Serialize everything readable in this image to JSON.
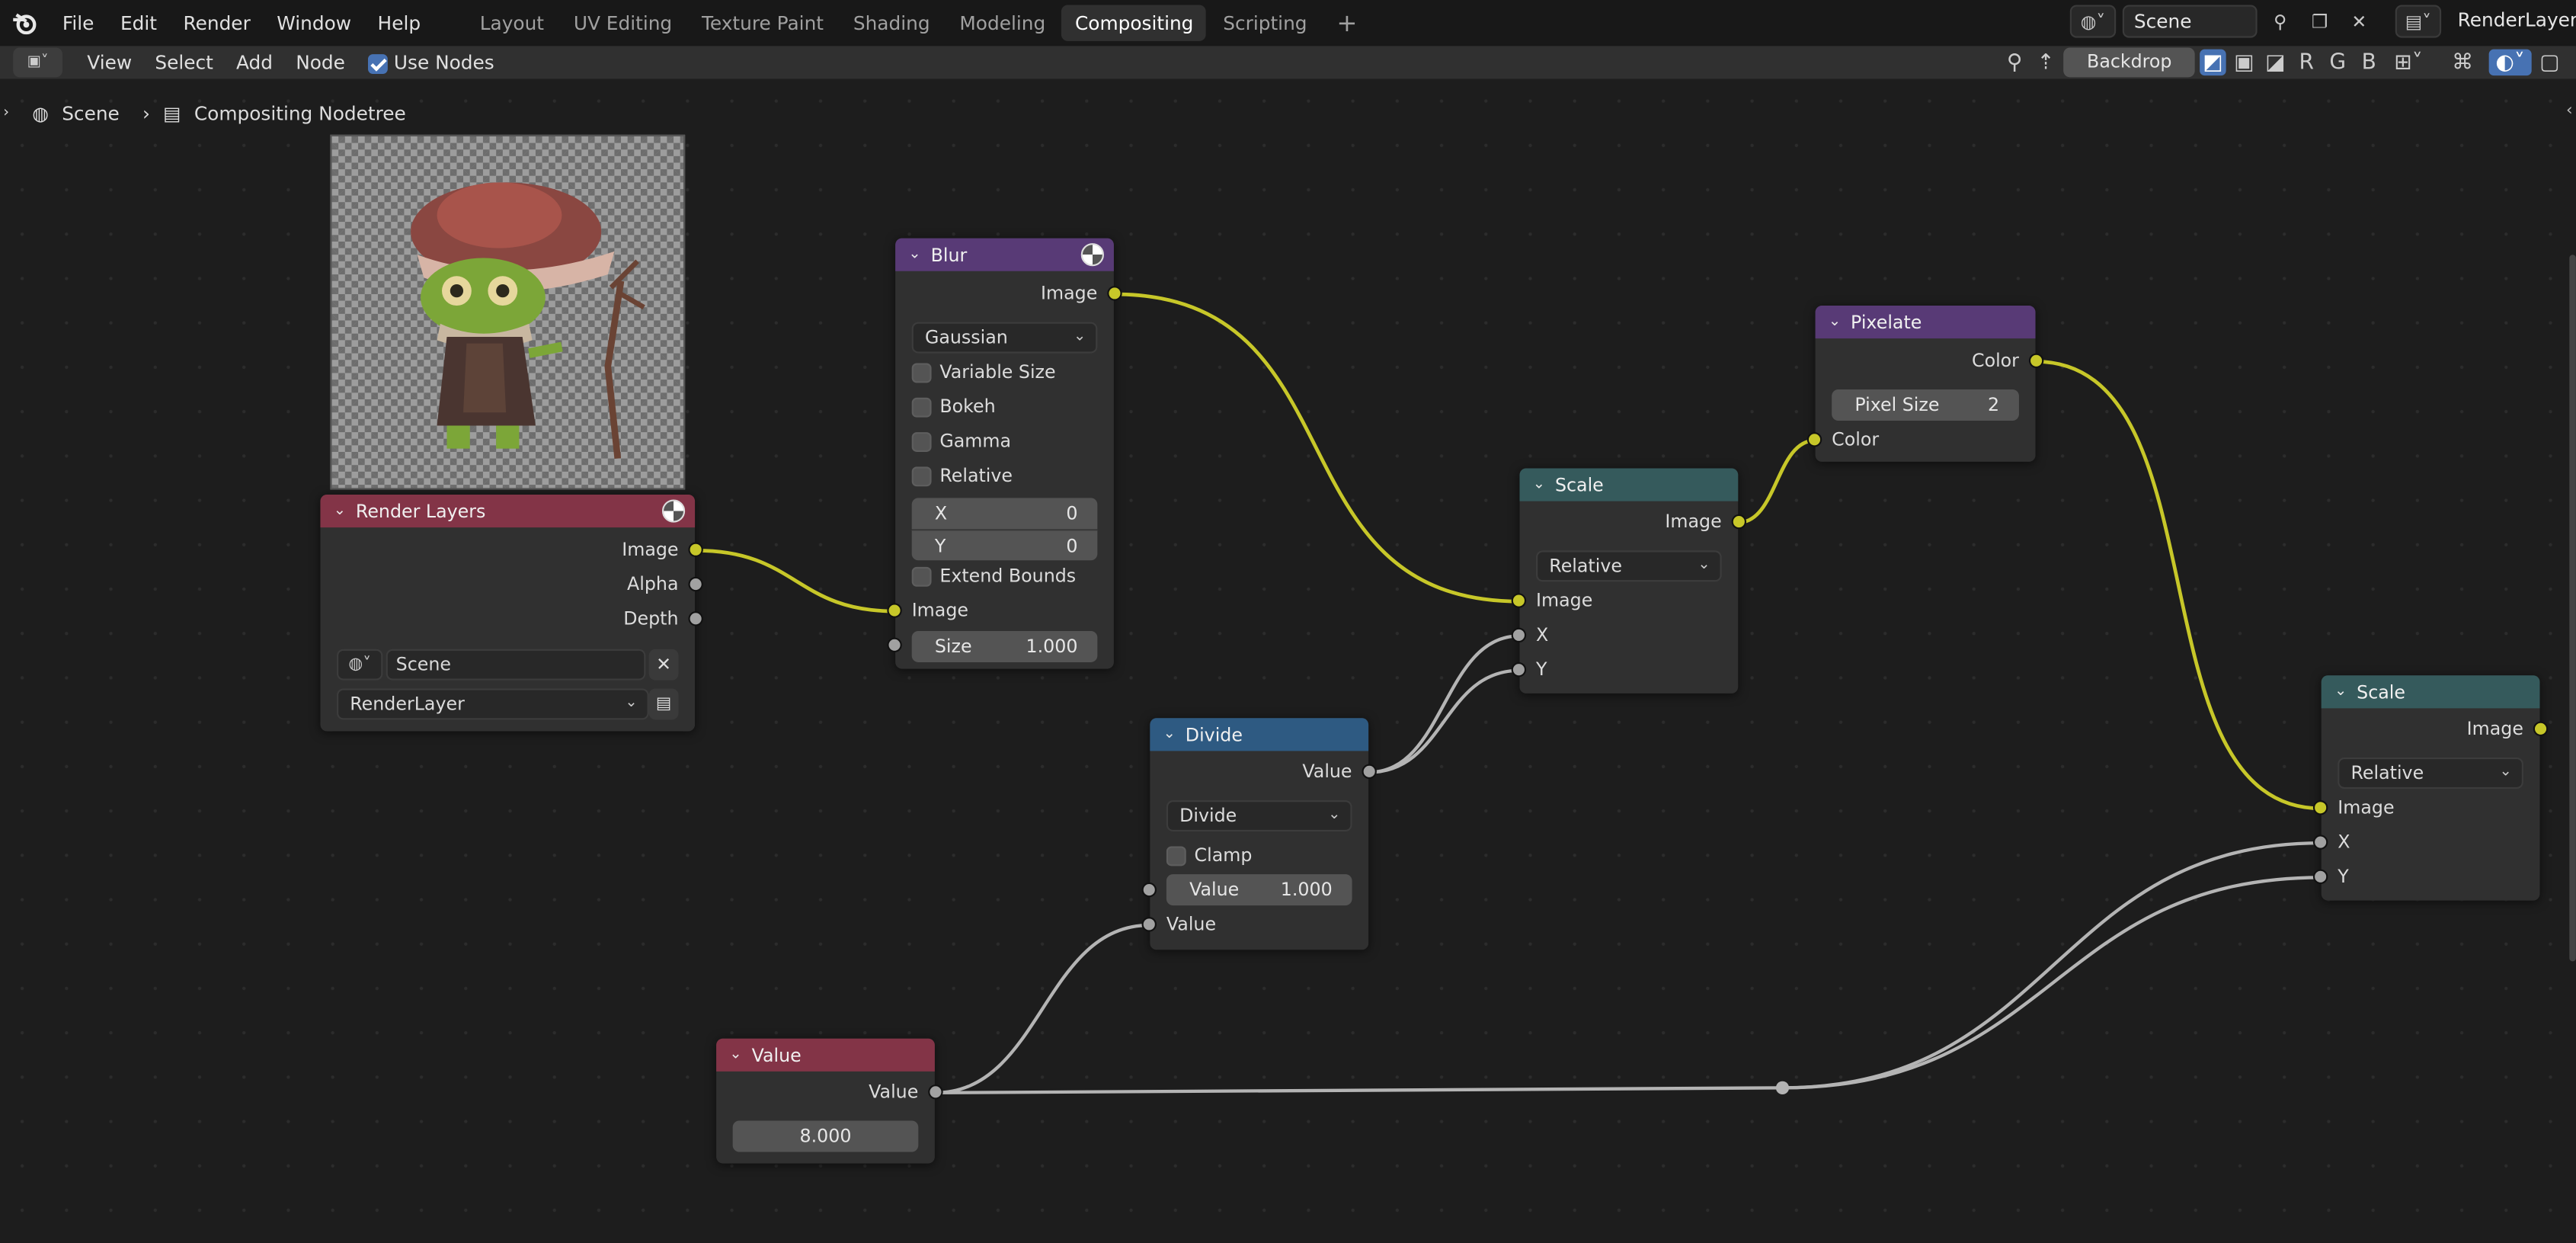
{
  "menu": {
    "file": "File",
    "edit": "Edit",
    "render": "Render",
    "window": "Window",
    "help": "Help"
  },
  "workspaces": [
    "Layout",
    "UV Editing",
    "Texture Paint",
    "Shading",
    "Modeling",
    "Compositing",
    "Scripting"
  ],
  "active_workspace": "Compositing",
  "scene_field": "Scene",
  "view_layer_field": "RenderLayer",
  "header": {
    "view": "View",
    "select": "Select",
    "add": "Add",
    "node": "Node",
    "use_nodes": "Use Nodes",
    "backdrop": "Backdrop",
    "ch_r": "R",
    "ch_g": "G",
    "ch_b": "B"
  },
  "breadcrumb": {
    "scene": "Scene",
    "tree": "Compositing Nodetree"
  },
  "nodes": {
    "render_layers": {
      "title": "Render Layers",
      "out_image": "Image",
      "out_alpha": "Alpha",
      "out_depth": "Depth",
      "scene": "Scene",
      "layer": "RenderLayer"
    },
    "blur": {
      "title": "Blur",
      "out_image": "Image",
      "filter": "Gaussian",
      "variable_size": "Variable Size",
      "bokeh": "Bokeh",
      "gamma": "Gamma",
      "relative": "Relative",
      "x_label": "X",
      "x_value": "0",
      "y_label": "Y",
      "y_value": "0",
      "extend_bounds": "Extend Bounds",
      "in_image": "Image",
      "size_label": "Size",
      "size_value": "1.000"
    },
    "pixelate": {
      "title": "Pixelate",
      "out_color": "Color",
      "pixel_size_label": "Pixel Size",
      "pixel_size_value": "2",
      "in_color": "Color"
    },
    "scale1": {
      "title": "Scale",
      "out_image": "Image",
      "mode": "Relative",
      "in_image": "Image",
      "in_x": "X",
      "in_y": "Y"
    },
    "divide": {
      "title": "Divide",
      "out_value": "Value",
      "op": "Divide",
      "clamp": "Clamp",
      "value_label": "Value",
      "value_value": "1.000",
      "in_value": "Value"
    },
    "value": {
      "title": "Value",
      "out_value": "Value",
      "value": "8.000"
    },
    "scale2": {
      "title": "Scale",
      "out_image": "Image",
      "mode": "Relative",
      "in_image": "Image",
      "in_x": "X",
      "in_y": "Y"
    }
  },
  "colors": {
    "input_header": "#833447",
    "filter_header": "#583a76",
    "distort_header": "#355a5c",
    "converter_header": "#2e5a82",
    "image_socket": "#c7c729",
    "value_socket": "#a1a1a1",
    "accent": "#4772b3"
  }
}
